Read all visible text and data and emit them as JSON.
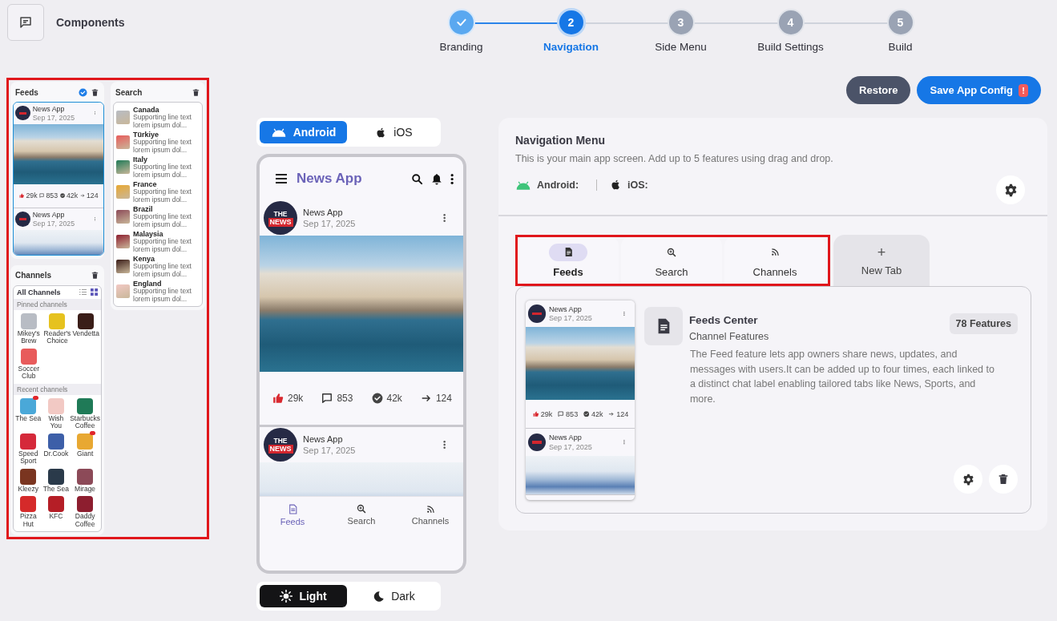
{
  "header": {
    "title": "Components"
  },
  "stepper": [
    {
      "label": "Branding",
      "done": true,
      "selected": false
    },
    {
      "number": "2",
      "label": "Navigation",
      "done": false,
      "selected": true
    },
    {
      "number": "3",
      "label": "Side Menu",
      "done": false,
      "selected": false
    },
    {
      "number": "4",
      "label": "Build Settings",
      "done": false,
      "selected": false
    },
    {
      "number": "5",
      "label": "Build",
      "done": false,
      "selected": false
    }
  ],
  "components": [
    {
      "kind": "feeds",
      "title": "Feeds",
      "checked": true,
      "posts": [
        {
          "author": "News App",
          "date": "Sep 17, 2025",
          "stats": [
            {
              "kind": "likes",
              "value": "29k"
            },
            {
              "kind": "comments",
              "value": "853"
            },
            {
              "kind": "reads",
              "value": "42k"
            },
            {
              "kind": "shares",
              "value": "124"
            }
          ]
        },
        {
          "author": "News App",
          "date": "Sep 17, 2025"
        }
      ]
    },
    {
      "kind": "search",
      "title": "Search",
      "checked": false,
      "results": [
        {
          "name": "Canada",
          "subtitle": "Supporting line text lorem ipsum dol..."
        },
        {
          "name": "Türkiye",
          "subtitle": "Supporting line text lorem ipsum dol..."
        },
        {
          "name": "Italy",
          "subtitle": "Supporting line text lorem ipsum dol..."
        },
        {
          "name": "France",
          "subtitle": "Supporting line text lorem ipsum dol..."
        },
        {
          "name": "Brazil",
          "subtitle": "Supporting line text lorem ipsum dol..."
        },
        {
          "name": "Malaysia",
          "subtitle": "Supporting line text lorem ipsum dol..."
        },
        {
          "name": "Kenya",
          "subtitle": "Supporting line text lorem ipsum dol..."
        },
        {
          "name": "England",
          "subtitle": "Supporting line text lorem ipsum dol..."
        }
      ]
    },
    {
      "kind": "channels",
      "title": "Channels",
      "checked": false,
      "heading": "All Channels",
      "view_modes": [
        {
          "kind": "list",
          "selected": false
        },
        {
          "kind": "grid",
          "selected": true
        }
      ],
      "sections": [
        {
          "title": "Pinned channels",
          "channels": [
            {
              "name": "Mikey's Brew",
              "badge": false
            },
            {
              "name": "Reader's Choice",
              "badge": false
            },
            {
              "name": "Vendetta",
              "badge": false
            },
            {
              "name": "Soccer Club",
              "badge": false
            }
          ]
        },
        {
          "title": "Recent channels",
          "channels": [
            {
              "name": "The Sea",
              "badge": true
            },
            {
              "name": "Wish You",
              "badge": false
            },
            {
              "name": "Starbucks Coffee",
              "badge": false
            },
            {
              "name": "Speed Sport",
              "badge": false
            },
            {
              "name": "Dr.Cook",
              "badge": false
            },
            {
              "name": "Giant",
              "badge": true
            },
            {
              "name": "Kleezy",
              "badge": false
            },
            {
              "name": "The Sea",
              "badge": false
            },
            {
              "name": "Mirage",
              "badge": false
            },
            {
              "name": "Pizza Hut",
              "badge": false
            },
            {
              "name": "KFC",
              "badge": false
            },
            {
              "name": "Daddy Coffee",
              "badge": false
            }
          ]
        }
      ]
    }
  ],
  "actions": [
    {
      "kind": "secondary",
      "label": "Restore"
    },
    {
      "kind": "primary",
      "label": "Save App Config",
      "alert": "!"
    }
  ],
  "platform_toggle": [
    {
      "kind": "android",
      "label": "Android",
      "selected": true
    },
    {
      "kind": "ios",
      "label": "iOS",
      "selected": false
    }
  ],
  "phone": {
    "title": "News App",
    "posts": [
      {
        "logo": {
          "line1": "THE",
          "line2": "NEWS"
        },
        "author": "News App",
        "date": "Sep 17, 2025",
        "stats": [
          {
            "kind": "likes",
            "value": "29k"
          },
          {
            "kind": "comments",
            "value": "853"
          },
          {
            "kind": "reads",
            "value": "42k"
          },
          {
            "kind": "shares",
            "value": "124"
          }
        ]
      },
      {
        "logo": {
          "line1": "THE",
          "line2": "NEWS"
        },
        "author": "News App",
        "date": "Sep 17, 2025"
      }
    ],
    "nav": [
      {
        "kind": "feeds",
        "label": "Feeds",
        "selected": true
      },
      {
        "kind": "search",
        "label": "Search",
        "selected": false
      },
      {
        "kind": "channels",
        "label": "Channels",
        "selected": false
      }
    ]
  },
  "theme_toggle": [
    {
      "kind": "light",
      "label": "Light",
      "selected": true
    },
    {
      "kind": "dark",
      "label": "Dark",
      "selected": false
    }
  ],
  "nav_panel": {
    "title": "Navigation Menu",
    "description": "This is your main app screen. Add up to 5 features using drag and drop.",
    "platforms": [
      {
        "kind": "android",
        "label": "Android:"
      },
      {
        "kind": "ios",
        "label": "iOS:"
      }
    ],
    "tabs": [
      {
        "kind": "feeds",
        "label": "Feeds",
        "selected": true
      },
      {
        "kind": "search",
        "label": "Search",
        "selected": false
      },
      {
        "kind": "channels",
        "label": "Channels",
        "selected": false
      }
    ],
    "new_tab": {
      "icon": "+",
      "label": "New Tab"
    },
    "feature": {
      "title": "Feeds Center",
      "subtitle": "Channel Features",
      "count": "78 Features",
      "description": "The Feed feature lets app owners share news, updates, and messages with users.It can be added up to four times, each linked to a distinct chat label enabling tailored tabs like News, Sports, and more.",
      "preview": [
        {
          "author": "News App",
          "date": "Sep 17, 2025",
          "stats": [
            {
              "kind": "likes",
              "value": "29k"
            },
            {
              "kind": "comments",
              "value": "853"
            },
            {
              "kind": "reads",
              "value": "42k"
            },
            {
              "kind": "shares",
              "value": "124"
            }
          ]
        },
        {
          "author": "News App",
          "date": "Sep 17, 2025"
        }
      ]
    }
  }
}
